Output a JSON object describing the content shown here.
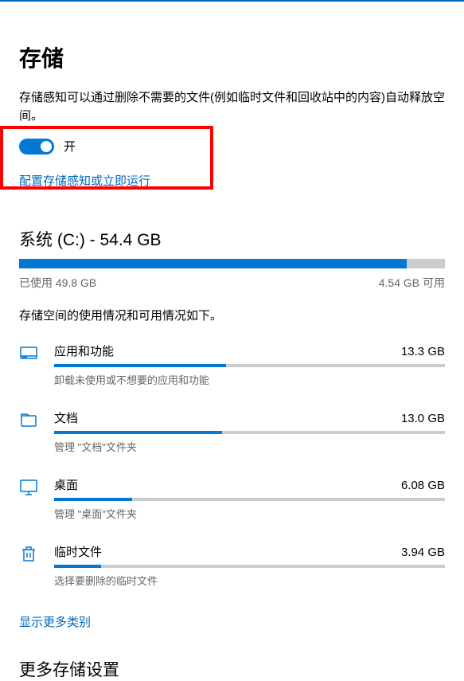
{
  "header": {
    "title": "存储"
  },
  "storage_sense": {
    "description": "存储感知可以通过删除不需要的文件(例如临时文件和回收站中的内容)自动释放空间。",
    "toggle_label": "开",
    "toggle_on": true,
    "configure_link": "配置存储感知或立即运行"
  },
  "drive": {
    "title": "系统 (C:) - 54.4 GB",
    "used_label": "已使用 49.8 GB",
    "free_label": "4.54 GB 可用",
    "fill_percent": 91,
    "breakdown_label": "存储空间的使用情况和可用情况如下。",
    "categories": [
      {
        "icon": "apps",
        "name": "应用和功能",
        "size": "13.3 GB",
        "percent": 44,
        "desc": "卸载未使用或不想要的应用和功能"
      },
      {
        "icon": "documents",
        "name": "文档",
        "size": "13.0 GB",
        "percent": 43,
        "desc": "管理 \"文档\"文件夹"
      },
      {
        "icon": "desktop",
        "name": "桌面",
        "size": "6.08 GB",
        "percent": 20,
        "desc": "管理 \"桌面\"文件夹"
      },
      {
        "icon": "trash",
        "name": "临时文件",
        "size": "3.94 GB",
        "percent": 12,
        "desc": "选择要删除的临时文件"
      }
    ],
    "show_more": "显示更多类别"
  },
  "more_settings": {
    "title": "更多存储设置"
  }
}
